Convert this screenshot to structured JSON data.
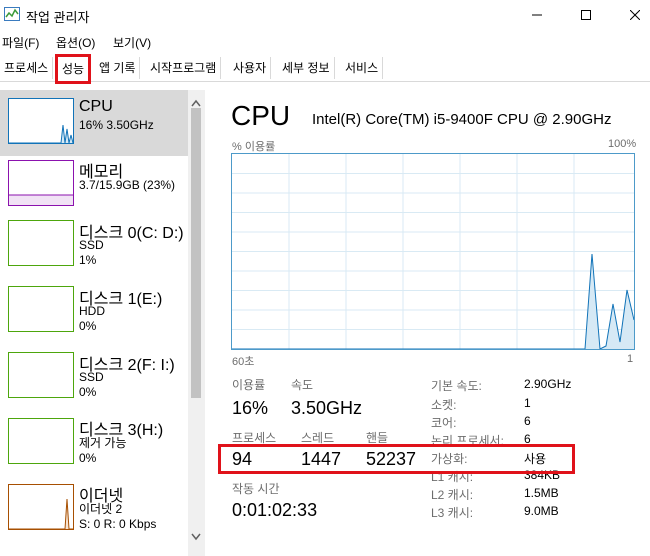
{
  "window": {
    "title": "작업 관리자",
    "minimize": "—",
    "maximize": "☐",
    "close": "✕"
  },
  "menu": [
    "파일(F)",
    "옵션(O)",
    "보기(V)"
  ],
  "tabs": [
    "프로세스",
    "성능",
    "앱 기록",
    "시작프로그램",
    "사용자",
    "세부 정보",
    "서비스"
  ],
  "sidebar": {
    "cpu": {
      "title": "CPU",
      "sub1": "16% 3.50GHz"
    },
    "memory": {
      "title": "메모리",
      "sub1": "3.7/15.9GB (23%)"
    },
    "disk0": {
      "title": "디스크 0(C: D:)",
      "sub1": "SSD",
      "sub2": "1%"
    },
    "disk1": {
      "title": "디스크 1(E:)",
      "sub1": "HDD",
      "sub2": "0%"
    },
    "disk2": {
      "title": "디스크 2(F: I:)",
      "sub1": "SSD",
      "sub2": "0%"
    },
    "disk3": {
      "title": "디스크 3(H:)",
      "sub1": "제거 가능",
      "sub2": "0%"
    },
    "ethernet": {
      "title": "이더넷",
      "sub1": "이더넷 2",
      "sub2": "S: 0 R: 0 Kbps"
    }
  },
  "main": {
    "title": "CPU",
    "model": "Intel(R) Core(TM) i5-9400F CPU @ 2.90GHz",
    "graph_label": "% 이용률",
    "graph_max": "100%",
    "graph_time": "60초",
    "graph_end": "1",
    "stats": {
      "util_label": "이용률",
      "util_value": "16%",
      "speed_label": "속도",
      "speed_value": "3.50GHz",
      "proc_label": "프로세스",
      "proc_value": "94",
      "thread_label": "스레드",
      "thread_value": "1447",
      "handle_label": "핸들",
      "handle_value": "52237",
      "uptime_label": "작동 시간",
      "uptime_value": "0:01:02:33"
    },
    "info": [
      {
        "label": "기본 속도:",
        "value": "2.90GHz"
      },
      {
        "label": "소켓:",
        "value": "1"
      },
      {
        "label": "코어:",
        "value": "6"
      },
      {
        "label": "논리 프로세서:",
        "value": "6"
      },
      {
        "label": "가상화:",
        "value": "사용"
      },
      {
        "label": "L1 캐시:",
        "value": "384KB"
      },
      {
        "label": "L2 캐시:",
        "value": "1.5MB"
      },
      {
        "label": "L3 캐시:",
        "value": "9.0MB"
      }
    ]
  },
  "colors": {
    "cpu": "#1173b8",
    "memory": "#8b12ae",
    "disk": "#4da60c",
    "ethernet": "#a74f01",
    "highlight": "#e0121a",
    "selected": "#cce8ff"
  }
}
